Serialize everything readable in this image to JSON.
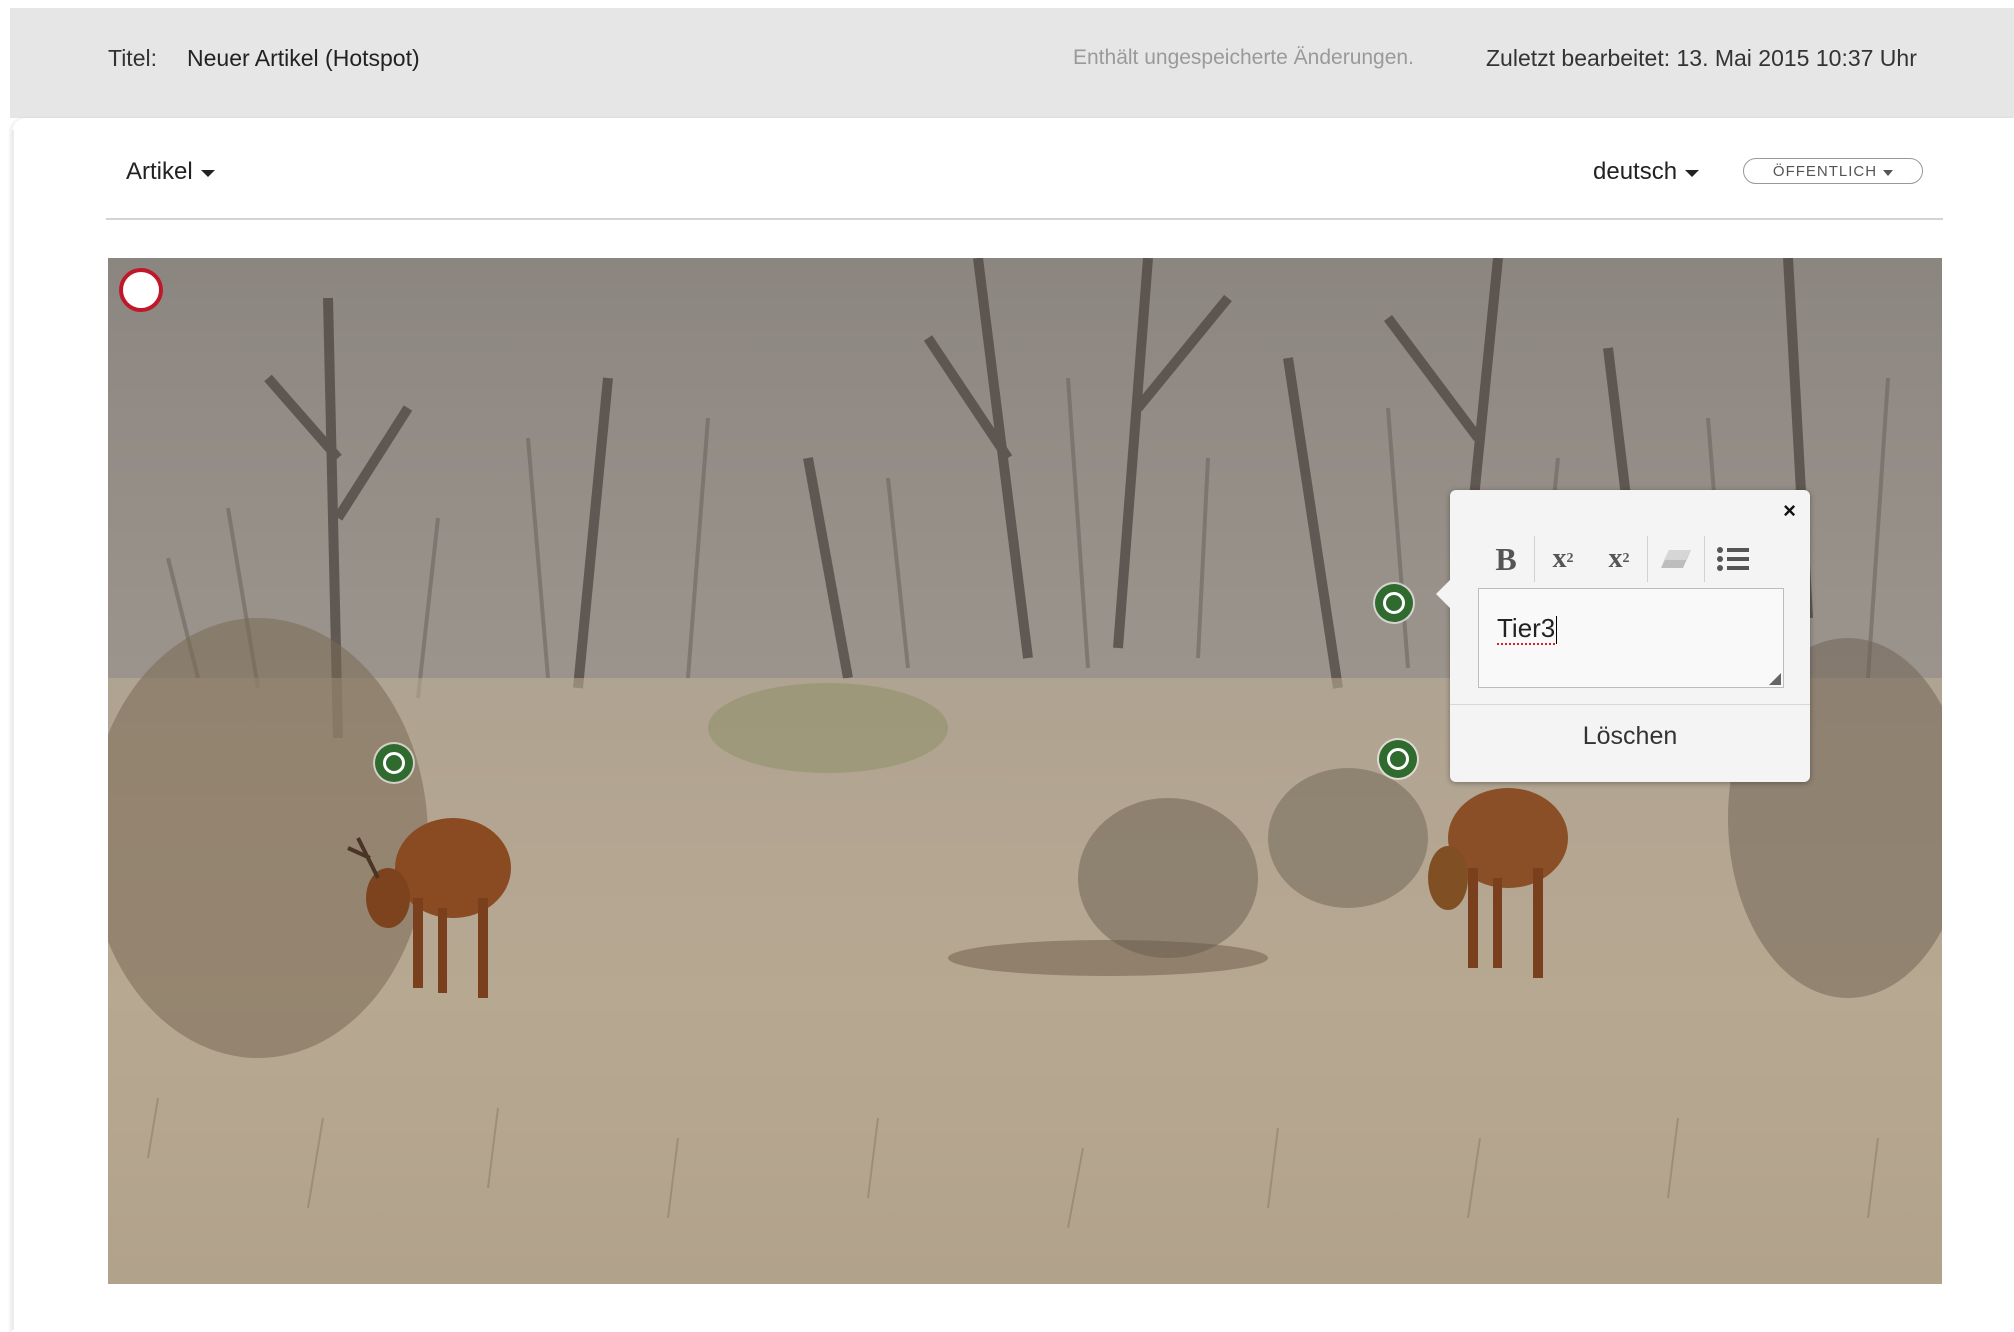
{
  "header": {
    "title_label": "Titel:",
    "title_value": "Neuer Artikel (Hotspot)",
    "unsaved_notice": "Enthält ungespeicherte Änderungen.",
    "last_edited": "Zuletzt bearbeitet: 13. Mai 2015 10:37 Uhr"
  },
  "toolbar": {
    "article_menu": "Artikel",
    "language_menu": "deutsch",
    "visibility": "ÖFFENTLICH"
  },
  "popover": {
    "text_value": "Tier3",
    "delete_label": "Löschen",
    "close_glyph": "×",
    "buttons": [
      "bold-icon",
      "superscript-icon",
      "subscript-icon",
      "eraser-icon",
      "list-icon"
    ]
  },
  "colors": {
    "hotspot": "#2f6b2f",
    "add_hotspot_ring": "#c0182a",
    "header_bg": "#e6e6e6"
  }
}
